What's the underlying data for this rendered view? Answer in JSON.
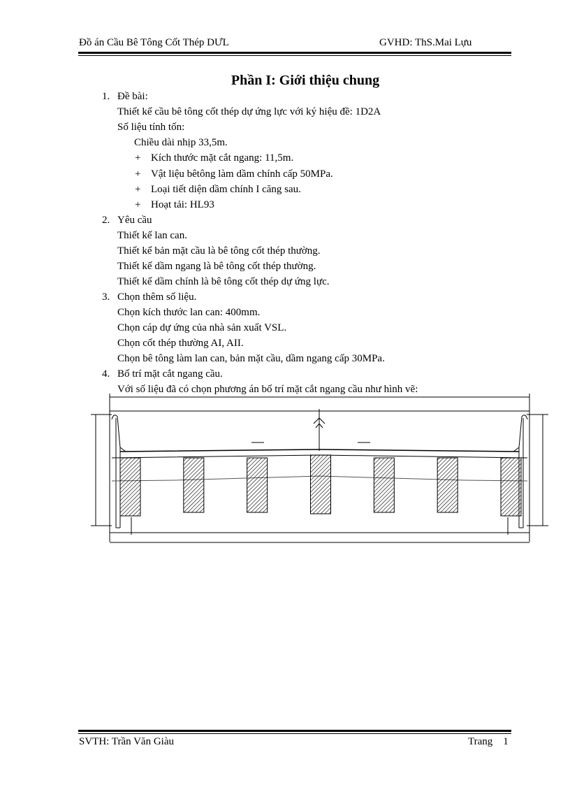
{
  "header": {
    "left": "Đồ án Cầu Bê Tông Cốt Thép DƯL",
    "right": "GVHD:  ThS.Mai  Lựu"
  },
  "title": "Phần I: Giới thiệu chung",
  "sections": [
    {
      "num": "1.",
      "heading": "Đề bài:",
      "lines": [
        "Thiết kế cầu bê tông cốt thép dự ứng lực với ký hiệu đề: 1D2A",
        "Số liệu tính tốn:"
      ],
      "sub": "Chiều dài nhịp 33,5m.",
      "bullets": [
        "Kích thước mặt cắt ngang:  11,5m.",
        "Vật liệu bêtông làm dầm chính cấp 50MPa.",
        "Loại tiết diện dầm chính I căng sau.",
        "Hoạt tải: HL93"
      ]
    },
    {
      "num": "2.",
      "heading": "Yêu cầu",
      "lines": [
        "Thiết kế lan can.",
        "Thiết kế bản mặt cầu là bê tông cốt thép thường.",
        "Thiết kế dầm ngang là bê tông cốt thép thường.",
        "Thiết kế dầm chính là bê tông cốt thép dự ứng lực."
      ]
    },
    {
      "num": "3.",
      "heading": "Chọn thêm số liệu.",
      "lines": [
        "Chọn kích thước lan can: 400mm.",
        "Chọn cáp dự ứng của nhà sản xuất VSL.",
        "Chọn cốt thép thường AI, AII.",
        "Chọn bê tông làm lan can, bản mặt cầu, dầm ngang cấp 30MPa."
      ]
    },
    {
      "num": "4.",
      "heading": "Bố trí mặt cắt ngang cầu.",
      "lines": [
        "Với số liệu đã có chọn phương án bố trí mặt cắt ngang cầu như hình vẽ:"
      ]
    }
  ],
  "bullet_symbol": "+",
  "drawing": {
    "girder_count": 7
  },
  "footer": {
    "left": "SVTH:  Trần Văn Giàu",
    "right": "Trang    1"
  }
}
